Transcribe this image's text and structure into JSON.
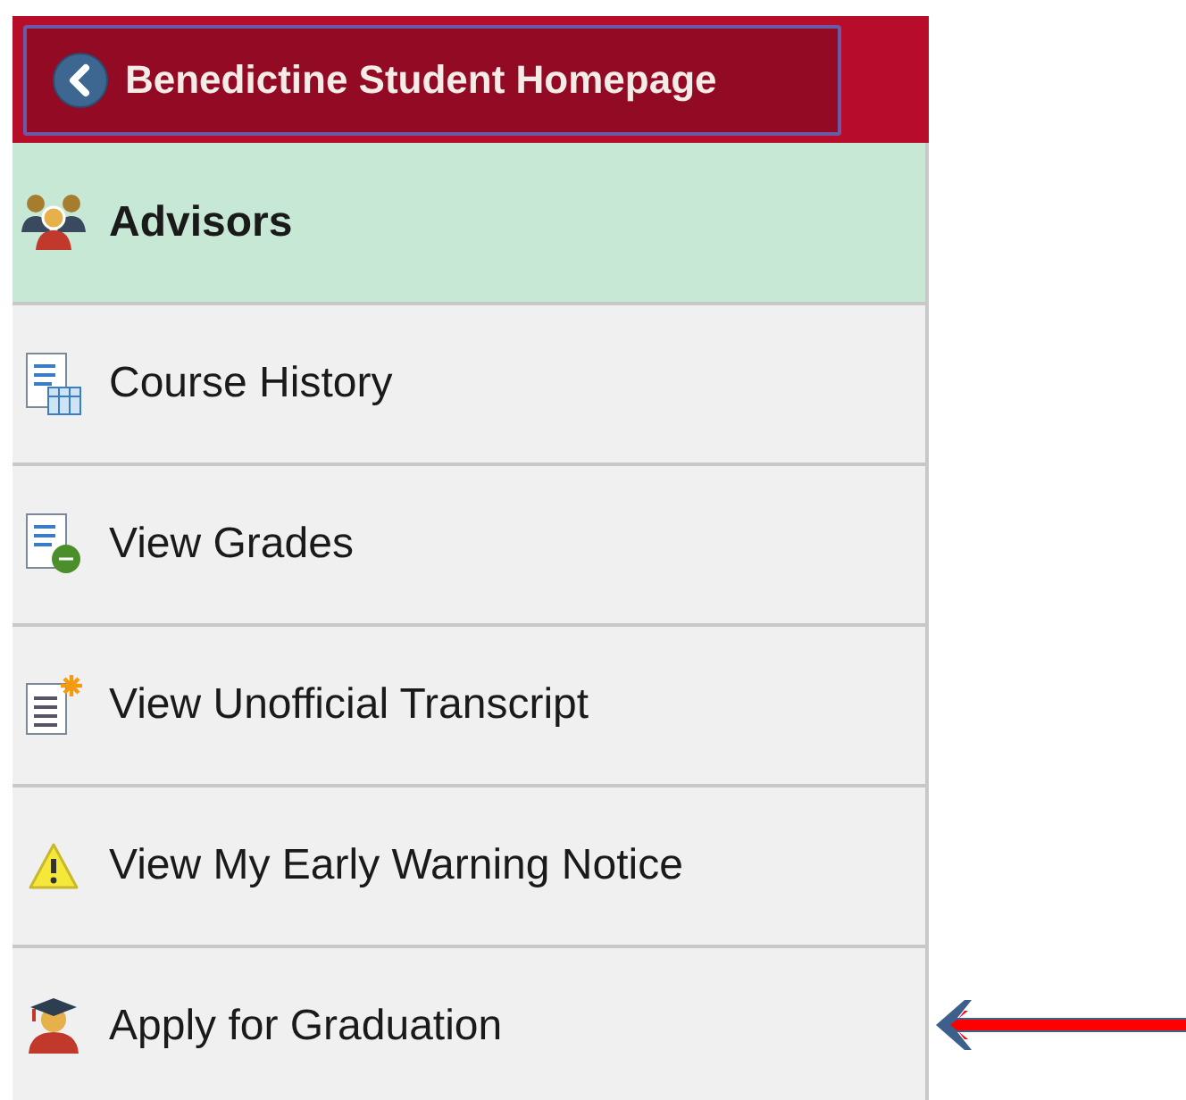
{
  "header": {
    "back_button": "Benedictine Student Homepage"
  },
  "nav_items": [
    {
      "label": "Advisors",
      "kind": "advisors",
      "selected": true
    },
    {
      "label": "Course History",
      "kind": "history",
      "selected": false
    },
    {
      "label": "View Grades",
      "kind": "grades",
      "selected": false
    },
    {
      "label": "View Unofficial Transcript",
      "kind": "transcript",
      "selected": false
    },
    {
      "label": "View My Early Warning Notice",
      "kind": "warning",
      "selected": false
    },
    {
      "label": "Apply for Graduation",
      "kind": "graduation",
      "selected": false
    }
  ],
  "annotation": {
    "kind": "arrow"
  }
}
